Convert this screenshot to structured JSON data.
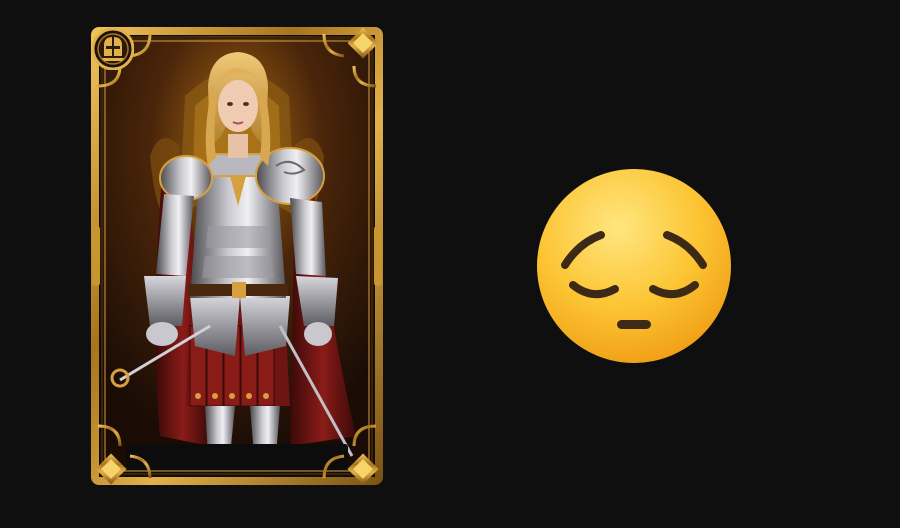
{
  "card": {
    "icon": "knight-helmet-icon",
    "portrait": "armored-blonde-knight",
    "nameplate_text": "",
    "colors": {
      "frame_gold": "#c8962e",
      "frame_dark": "#5a3a0c",
      "background": "#2a1407",
      "nameplate": "#0c0c0c",
      "cape": "#7a1a16"
    }
  },
  "emoji": {
    "icon": "pensive-face-icon",
    "colors": {
      "face_top": "#ffe066",
      "face_bottom": "#f3a81a",
      "features": "#3d2a16"
    }
  },
  "page": {
    "background": "#0f0f0f"
  }
}
